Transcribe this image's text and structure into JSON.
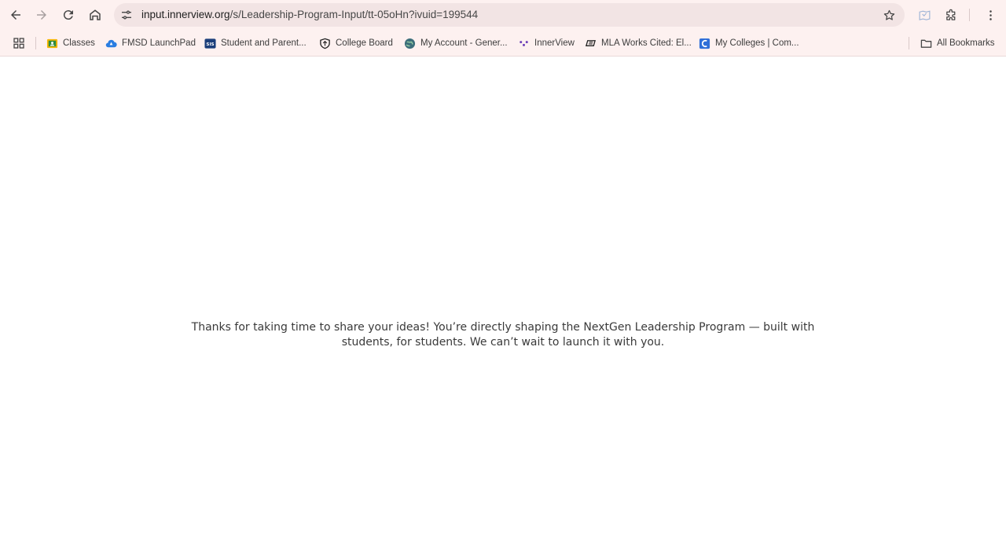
{
  "browser": {
    "url_domain": "input.innerview.org",
    "url_path": "/s/Leadership-Program-Input/tt-05oHn?ivuid=199544",
    "bookmarks": [
      {
        "label": "Classes",
        "icon": "google-classroom-icon"
      },
      {
        "label": "FMSD LaunchPad",
        "icon": "launchpad-cloud-icon"
      },
      {
        "label": "Student and Parent...",
        "icon": "sis-icon"
      },
      {
        "label": "College Board",
        "icon": "college-board-shield-icon"
      },
      {
        "label": "My Account - Gener...",
        "icon": "globe-icon"
      },
      {
        "label": "InnerView",
        "icon": "innerview-icon"
      },
      {
        "label": "MLA Works Cited: El...",
        "icon": "purdue-owl-icon"
      },
      {
        "label": "My Colleges | Com...",
        "icon": "common-app-icon"
      }
    ],
    "all_bookmarks_label": "All Bookmarks"
  },
  "page": {
    "message": "Thanks for taking  time to share your ideas! You’re directly shaping the NextGen Leadership Program — built with students, for students. We can’t wait to launch it with you."
  },
  "colors": {
    "chrome_bg": "#fdf1f0",
    "omnibox_bg": "#f2e4e4",
    "text": "#3a3a3a"
  }
}
